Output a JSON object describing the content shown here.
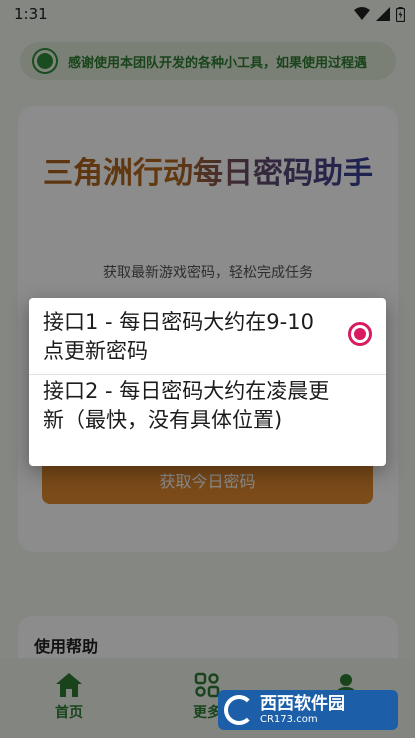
{
  "status_bar": {
    "time": "1:31",
    "icons": [
      "wifi-icon",
      "signal-icon",
      "battery-icon"
    ]
  },
  "notice": {
    "text": "感谢使用本团队开发的各种小工具，如果使用过程遇"
  },
  "title": "三角洲行动每日密码助手",
  "subtitle": "获取最新游戏密码，轻松完成任务",
  "fetch_button": "获取今日密码",
  "help": {
    "title": "使用帮助"
  },
  "bottom_nav": {
    "items": [
      {
        "label": "首页",
        "icon": "home-icon"
      },
      {
        "label": "更多",
        "icon": "apps-icon"
      },
      {
        "label": "",
        "icon": "user-icon"
      }
    ]
  },
  "dialog": {
    "options": [
      {
        "label": "接口1 - 每日密码大约在9-10点更新密码",
        "selected": true
      },
      {
        "label": "接口2 - 每日密码大约在凌晨更新（最快，没有具体位置)",
        "selected": false
      }
    ]
  },
  "watermark": {
    "main": "西西软件园",
    "sub": "CR173.com"
  },
  "colors": {
    "accent": "#2e7d32",
    "radio": "#d81b60",
    "button": "#e0892f",
    "title_start": "#a85f1f",
    "title_end": "#2c3d9e"
  }
}
